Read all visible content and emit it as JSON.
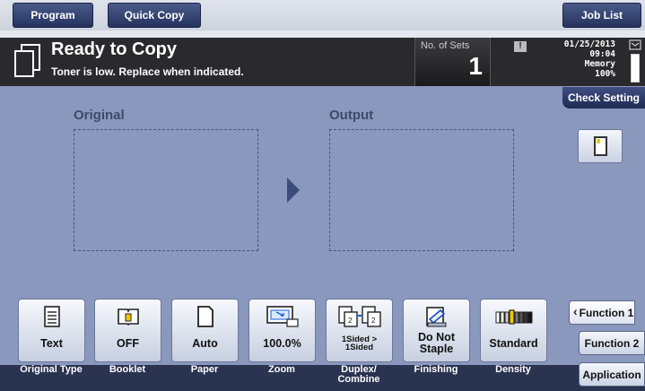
{
  "tabs": {
    "program": "Program",
    "quick_copy": "Quick Copy",
    "job_list": "Job List"
  },
  "status": {
    "title": "Ready to Copy",
    "message": "Toner is low. Replace when indicated.",
    "sets_label": "No. of Sets",
    "sets_value": "1",
    "date": "01/25/2013",
    "time": "09:04",
    "memory_label": "Memory",
    "memory_value": "100%"
  },
  "check_setting": "Check Setting",
  "main": {
    "original_label": "Original",
    "output_label": "Output"
  },
  "function_keys": [
    {
      "value": "Text",
      "label": "Original Type",
      "icon": "document-text-icon"
    },
    {
      "value": "OFF",
      "label": "Booklet",
      "icon": "booklet-icon"
    },
    {
      "value": "Auto",
      "label": "Paper",
      "icon": "paper-icon"
    },
    {
      "value": "100.0%",
      "label": "Zoom",
      "icon": "zoom-icon"
    },
    {
      "value": "1Sided > 1Sided",
      "label": "Duplex/ Combine",
      "icon": "duplex-icon"
    },
    {
      "value": "Do Not Staple",
      "label": "Finishing",
      "icon": "staple-icon"
    },
    {
      "value": "Standard",
      "label": "Density",
      "icon": "density-icon"
    }
  ],
  "side_buttons": {
    "function1": "Function 1",
    "function2": "Function 2",
    "application": "Application"
  },
  "colors": {
    "tab_bg": "#25335e",
    "main_bg": "#8a98be",
    "status_bg": "#2a2a2e"
  }
}
